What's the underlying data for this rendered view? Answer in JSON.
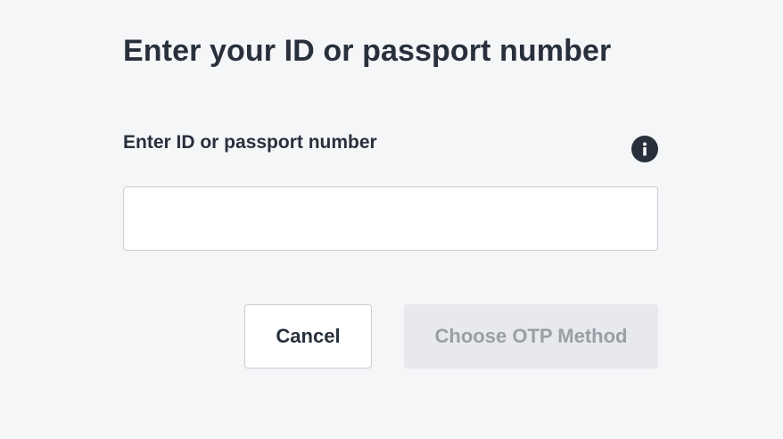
{
  "page": {
    "title": "Enter your ID or passport number"
  },
  "form": {
    "field_label": "Enter ID or passport number",
    "input_value": "",
    "input_placeholder": "",
    "info_icon": "info-icon"
  },
  "actions": {
    "cancel_label": "Cancel",
    "choose_otp_label": "Choose OTP Method",
    "choose_otp_disabled": true
  },
  "colors": {
    "background": "#f5f6f8",
    "text": "#28303c",
    "disabled_button_bg": "#e8e9ec",
    "disabled_button_text": "#9a9ea6"
  }
}
